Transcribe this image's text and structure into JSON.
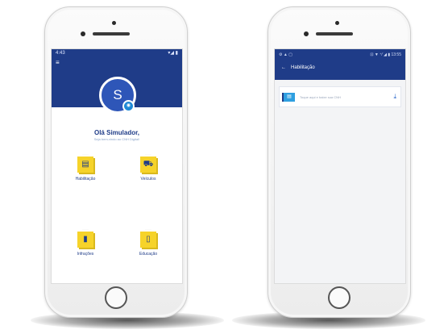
{
  "left_phone": {
    "status": {
      "time": "4:43",
      "signal": "▾◢ ▮"
    },
    "menu_icon": "≡",
    "avatar_letter": "S",
    "badge_icon": "camera-icon",
    "greeting": "Olá Simulador,",
    "subgreeting": "Seja bem-vindo ao CNH Digital!",
    "tiles": [
      {
        "tiny": "········",
        "label": "Habilitação",
        "icon": "id-card-icon",
        "glyph": "▤"
      },
      {
        "tiny": "········",
        "label": "Veículos",
        "icon": "car-icon",
        "glyph": "⛟"
      },
      {
        "tiny": "········",
        "label": "Infrações",
        "icon": "document-icon",
        "glyph": "▮"
      },
      {
        "tiny": "········",
        "label": "Educação",
        "icon": "book-icon",
        "glyph": "▯"
      }
    ]
  },
  "right_phone": {
    "status": {
      "left": "⚙ ▲ ▢",
      "right": "⊡ ▼ ⁺⁄ ◢ ▮ 13:55"
    },
    "back_icon": "←",
    "title": "Habilitação",
    "item": {
      "text": "Toque aqui e baixe sua CNH",
      "icon": "id-card-icon",
      "action": "download-icon"
    }
  },
  "colors": {
    "primary": "#1f3c88",
    "accent": "#f6d32a",
    "icon_blue": "#2e9fe0"
  }
}
